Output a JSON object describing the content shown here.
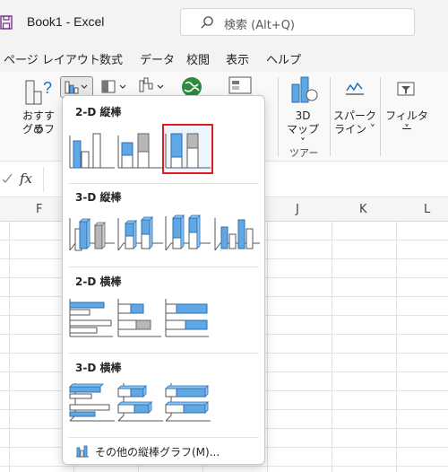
{
  "window": {
    "title": "Book1  -  Excel"
  },
  "search": {
    "placeholder": "検索 (Alt+Q)"
  },
  "tabs": [
    "ページ レイアウト",
    "数式",
    "データ",
    "校閲",
    "表示",
    "ヘルプ"
  ],
  "ribbon": {
    "recommended_line1": "おすすめ",
    "recommended_line2": "グラフ",
    "map3d_line1": "3D",
    "map3d_line2": "マップ ˅",
    "sparkline_line1": "スパーク",
    "sparkline_line2": "ライン ˅",
    "filter_line1": "フィルター",
    "filter_line2": "˅",
    "tour_group": "ツアー"
  },
  "formula_bar": {
    "fx": "fx"
  },
  "columns": [
    "F",
    "J",
    "K",
    "L"
  ],
  "dropdown": {
    "sections": [
      {
        "title": "2-D 縦棒"
      },
      {
        "title": "3-D 縦棒"
      },
      {
        "title": "2-D 横棒"
      },
      {
        "title": "3-D 横棒"
      }
    ],
    "more_label": "その他の縦棒グラフ(M)..."
  },
  "colors": {
    "accent": "#217346",
    "bar_blue": "#5fa8e5",
    "bar_gray": "#b7b7b7",
    "highlight": "#e01b22"
  }
}
